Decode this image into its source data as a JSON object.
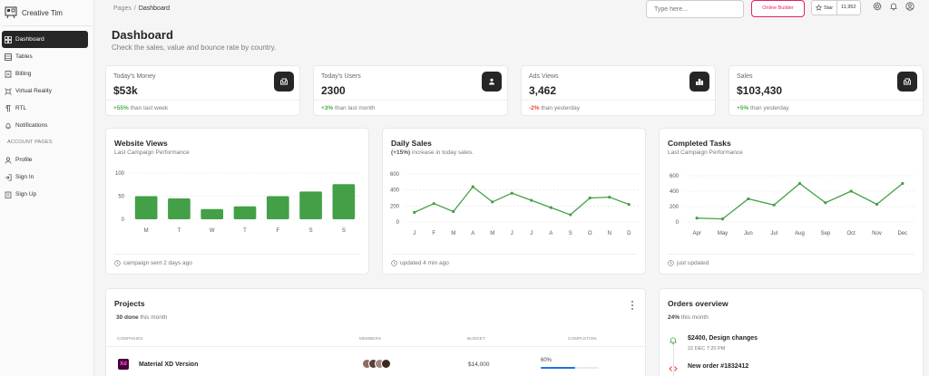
{
  "brand": {
    "name": "Creative Tim"
  },
  "sidebar": {
    "items": [
      {
        "label": "Dashboard",
        "icon": "dashboard-icon"
      },
      {
        "label": "Tables",
        "icon": "table-icon"
      },
      {
        "label": "Billing",
        "icon": "receipt-icon"
      },
      {
        "label": "Virtual Reality",
        "icon": "vr-icon"
      },
      {
        "label": "RTL",
        "icon": "rtl-icon"
      },
      {
        "label": "Notifications",
        "icon": "bell-icon"
      }
    ],
    "section_label": "ACCOUNT PAGES",
    "account_items": [
      {
        "label": "Profile",
        "icon": "person-icon"
      },
      {
        "label": "Sign In",
        "icon": "login-icon"
      },
      {
        "label": "Sign Up",
        "icon": "assignment-icon"
      }
    ]
  },
  "breadcrumb": {
    "root": "Pages",
    "separator": "/",
    "current": "Dashboard"
  },
  "topbar": {
    "search_placeholder": "Type here...",
    "builder_label": "Online Builder",
    "star_label": "Star",
    "star_count": "11,952"
  },
  "header": {
    "title": "Dashboard",
    "subtitle": "Check the sales, value and bounce rate by country."
  },
  "stats": [
    {
      "title": "Today's Money",
      "value": "$53k",
      "change": "+55%",
      "change_text": "than last week",
      "trend": "up"
    },
    {
      "title": "Today's Users",
      "value": "2300",
      "change": "+3%",
      "change_text": "than last month",
      "trend": "up"
    },
    {
      "title": "Ads Views",
      "value": "3,462",
      "change": "-2%",
      "change_text": "than yesterday",
      "trend": "down"
    },
    {
      "title": "Sales",
      "value": "$103,430",
      "change": "+5%",
      "change_text": "than yesterday",
      "trend": "up"
    }
  ],
  "charts": {
    "website_views": {
      "title": "Website Views",
      "subtitle": "Last Campaign Performance",
      "footer": "campaign sent 2 days ago"
    },
    "daily_sales": {
      "title": "Daily Sales",
      "subtitle_bold": "(+15%)",
      "subtitle_rest": "increase in today sales.",
      "footer": "updated 4 min ago"
    },
    "completed_tasks": {
      "title": "Completed Tasks",
      "subtitle": "Last Campaign Performance",
      "footer": "just updated"
    }
  },
  "chart_data": [
    {
      "type": "bar",
      "categories": [
        "M",
        "T",
        "W",
        "T",
        "F",
        "S",
        "S"
      ],
      "values": [
        50,
        45,
        22,
        28,
        50,
        60,
        76
      ],
      "yticks": [
        0,
        50,
        100
      ],
      "ylim": [
        0,
        100
      ],
      "color": "#43a047"
    },
    {
      "type": "line",
      "categories": [
        "J",
        "F",
        "M",
        "A",
        "M",
        "J",
        "J",
        "A",
        "S",
        "O",
        "N",
        "D"
      ],
      "values": [
        120,
        230,
        130,
        440,
        250,
        360,
        270,
        180,
        90,
        300,
        310,
        220
      ],
      "yticks": [
        0,
        200,
        400,
        600
      ],
      "ylim": [
        0,
        600
      ],
      "color": "#43a047"
    },
    {
      "type": "line",
      "categories": [
        "Apr",
        "May",
        "Jun",
        "Jul",
        "Aug",
        "Sep",
        "Oct",
        "Nov",
        "Dec"
      ],
      "values": [
        50,
        40,
        300,
        220,
        500,
        250,
        400,
        230,
        500
      ],
      "yticks": [
        0,
        200,
        400,
        600
      ],
      "ylim": [
        0,
        600
      ],
      "color": "#43a047"
    }
  ],
  "projects": {
    "title": "Projects",
    "done_count": "30 done",
    "done_rest": "this month",
    "columns": [
      "COMPANIES",
      "MEMBERS",
      "BUDGET",
      "COMPLETION"
    ],
    "rows": [
      {
        "company": "Material XD Version",
        "logo": "Xd",
        "budget": "$14,000",
        "completion": "60%",
        "completion_value": 0.6
      }
    ]
  },
  "orders": {
    "title": "Orders overview",
    "pct": "24%",
    "pct_rest": "this month",
    "items": [
      {
        "title": "$2400, Design changes",
        "date": "22 DEC 7:20 PM",
        "icon": "bell-icon"
      },
      {
        "title": "New order #1832412",
        "icon": "code-icon"
      }
    ]
  },
  "colors": {
    "accent": "#e91e63",
    "dark": "#262626",
    "green": "#4caf50",
    "red": "#f44335",
    "blue": "#1a73e8"
  }
}
